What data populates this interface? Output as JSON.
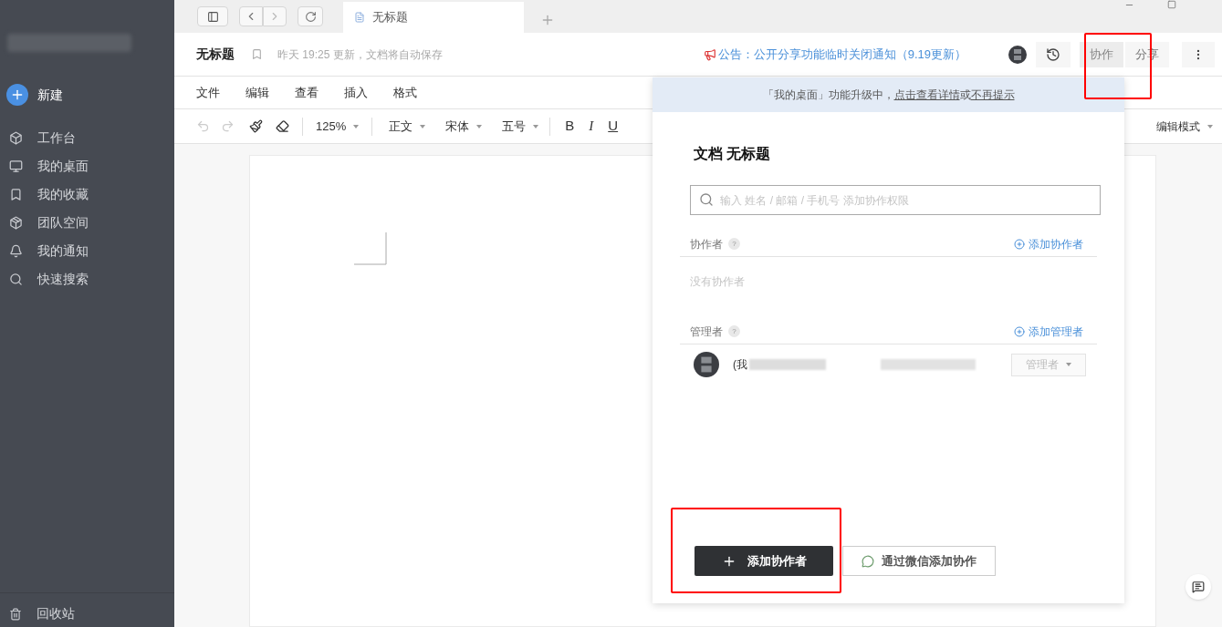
{
  "sidebar": {
    "new_button": "新建",
    "items": [
      {
        "label": "工作台"
      },
      {
        "label": "我的桌面"
      },
      {
        "label": "我的收藏"
      },
      {
        "label": "团队空间"
      },
      {
        "label": "我的通知"
      },
      {
        "label": "快速搜索"
      }
    ],
    "trash": "回收站"
  },
  "browser_tab": {
    "title": "无标题"
  },
  "doc_header": {
    "title": "无标题",
    "status": "昨天 19:25 更新，文档将自动保存",
    "announcement": "公告：公开分享功能临时关闭通知（9.19更新）",
    "buttons": [
      {
        "label": "协作",
        "selected": true
      },
      {
        "label": "分享",
        "selected": false
      }
    ]
  },
  "menu": [
    "文件",
    "编辑",
    "查看",
    "插入",
    "格式"
  ],
  "toolbar": {
    "zoom": "125%",
    "style": "正文",
    "font": "宋体",
    "size": "五号",
    "format_buttons": [
      "B",
      "I",
      "U"
    ],
    "mode": "编辑模式"
  },
  "share_panel": {
    "notice": [
      {
        "kind": "text",
        "text": "「我的桌面」功能升级中，"
      },
      {
        "kind": "link",
        "text": "点击查看详情"
      },
      {
        "kind": "text",
        "text": "或"
      },
      {
        "kind": "link",
        "text": "不再提示"
      }
    ],
    "title": "文档 无标题",
    "search_placeholder": "输入 姓名 / 邮箱 / 手机号 添加协作权限",
    "collaborators": {
      "label": "协作者",
      "help": "?",
      "add": "添加协作者",
      "empty": "没有协作者"
    },
    "managers": {
      "label": "管理者",
      "help": "?",
      "add": "添加管理者",
      "members": [
        {
          "name": "(我",
          "role": "管理者"
        }
      ]
    },
    "primary_button": "添加协作者",
    "wechat_button": "通过微信添加协作"
  }
}
